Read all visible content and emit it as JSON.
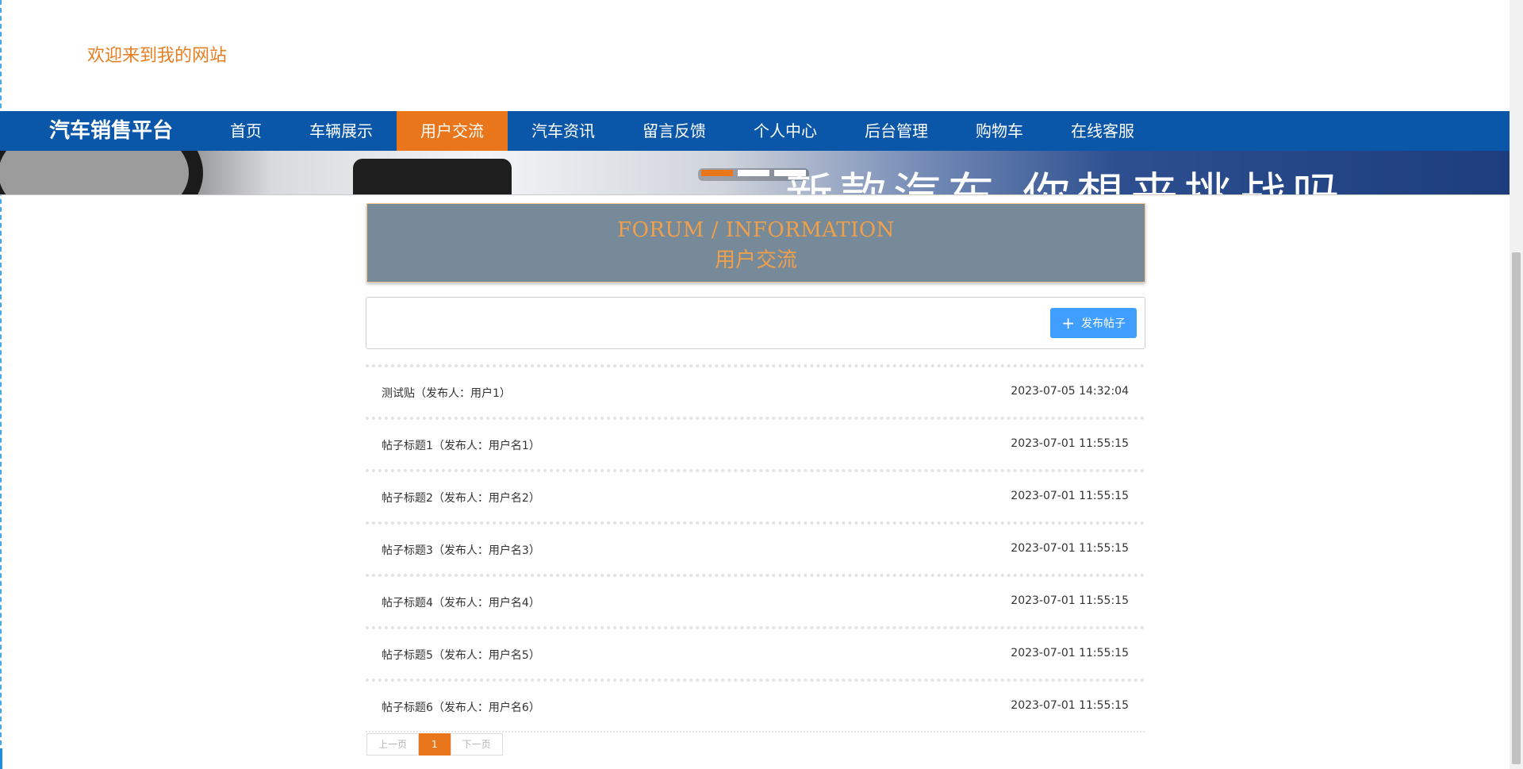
{
  "site": {
    "welcome": "欢迎来到我的网站",
    "brand": "汽车销售平台"
  },
  "nav": {
    "items": [
      {
        "label": "首页",
        "active": false
      },
      {
        "label": "车辆展示",
        "active": false
      },
      {
        "label": "用户交流",
        "active": true
      },
      {
        "label": "汽车资讯",
        "active": false
      },
      {
        "label": "留言反馈",
        "active": false
      },
      {
        "label": "个人中心",
        "active": false
      },
      {
        "label": "后台管理",
        "active": false
      },
      {
        "label": "购物车",
        "active": false
      },
      {
        "label": "在线客服",
        "active": false
      }
    ]
  },
  "banner": {
    "text": "新款汽车 你想来挑战吗",
    "slide_count": 3,
    "active_slide": 1
  },
  "section": {
    "title_en": "FORUM / INFORMATION",
    "title_cn": "用户交流"
  },
  "toolbar": {
    "post_button_label": "发布帖子",
    "post_button_icon": "plus-icon"
  },
  "posts": [
    {
      "title": "测试贴（发布人：用户1）",
      "time": "2023-07-05 14:32:04"
    },
    {
      "title": "帖子标题1（发布人：用户名1）",
      "time": "2023-07-01 11:55:15"
    },
    {
      "title": "帖子标题2（发布人：用户名2）",
      "time": "2023-07-01 11:55:15"
    },
    {
      "title": "帖子标题3（发布人：用户名3）",
      "time": "2023-07-01 11:55:15"
    },
    {
      "title": "帖子标题4（发布人：用户名4）",
      "time": "2023-07-01 11:55:15"
    },
    {
      "title": "帖子标题5（发布人：用户名5）",
      "time": "2023-07-01 11:55:15"
    },
    {
      "title": "帖子标题6（发布人：用户名6）",
      "time": "2023-07-01 11:55:15"
    }
  ],
  "pagination": {
    "prev_label": "上一页",
    "current_page": "1",
    "next_label": "下一页"
  },
  "colors": {
    "nav_bg": "#0a56a8",
    "accent": "#e9761a",
    "header_bg": "#768a99",
    "header_text": "#f0a04a",
    "button_primary": "#409eff"
  }
}
